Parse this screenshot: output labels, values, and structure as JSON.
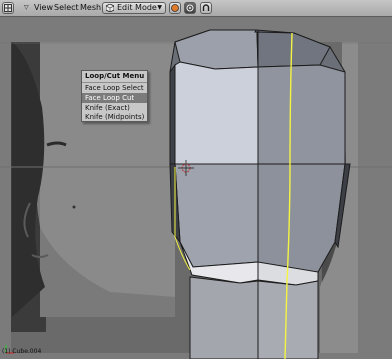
{
  "header": {
    "menus": [
      "View",
      "Select",
      "Mesh"
    ],
    "mode": "Edit Mode"
  },
  "popup_menu": {
    "title": "Loop/Cut Menu",
    "items": [
      "Face Loop Select",
      "Face Loop Cut",
      "Knife (Exact)",
      "Knife (Midpoints)"
    ],
    "highlighted_index": 1
  },
  "status": {
    "object_label": "(1) Cube.004"
  },
  "colors": {
    "accent_edge": "#f4f442",
    "menu_highlight": "#7b7b7b"
  }
}
